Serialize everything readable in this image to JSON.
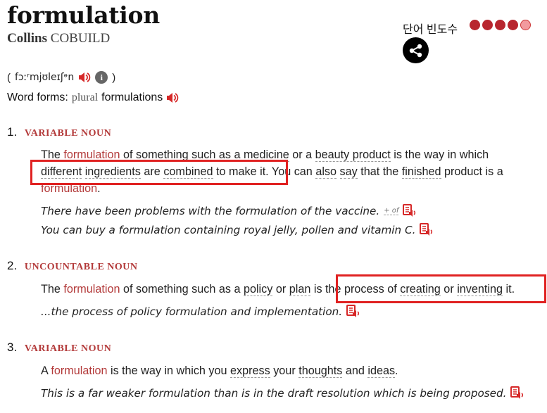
{
  "header": {
    "headword": "formulation",
    "dictionary_brand": "Collins",
    "dictionary_name": "COBUILD",
    "frequency_label": "단어 빈도수",
    "frequency_level": 4,
    "frequency_max": 5
  },
  "pronunciation": {
    "open": "(",
    "ipa": "fɔːʳmjʊleɪʃᵊn",
    "close": ")"
  },
  "word_forms": {
    "label": "Word forms:",
    "plural_label": "plural",
    "plural_value": "formulations"
  },
  "senses": [
    {
      "number": "1.",
      "pos": "VARIABLE NOUN",
      "definition_parts": [
        "The ",
        "formulation",
        " of something such as a ",
        "medicine",
        " or a ",
        "beauty product",
        " is the way in which ",
        "different",
        " ",
        "ingredients",
        " are ",
        "combined",
        " to make it.",
        " You can ",
        "also",
        " ",
        "say",
        " that the ",
        "finished",
        " product is a ",
        "formulation",
        "."
      ],
      "examples": [
        {
          "text": "There have been problems with the formulation of the vaccine.",
          "extra": "+ of"
        },
        {
          "text": "You can buy a formulation containing royal jelly, pollen and vitamin C."
        }
      ]
    },
    {
      "number": "2.",
      "pos": "UNCOUNTABLE NOUN",
      "definition_parts": [
        "The ",
        "formulation",
        " of something such as a ",
        "policy",
        " or ",
        "plan",
        " is ",
        "the process of ",
        "creating",
        " or ",
        "inventing",
        " it."
      ],
      "examples": [
        {
          "text": "...the process of policy formulation and implementation."
        }
      ]
    },
    {
      "number": "3.",
      "pos": "VARIABLE NOUN",
      "definition_parts": [
        "A ",
        "formulation",
        " is the way in which you ",
        "express",
        " your ",
        "thoughts",
        " and ",
        "ideas",
        "."
      ],
      "examples": [
        {
          "text": "This is a far weaker formulation than is in the draft resolution which is being proposed."
        }
      ]
    }
  ],
  "colors": {
    "accent": "#b33a3a",
    "highlight_box": "#e02222",
    "freq_dot": "#b8262f"
  },
  "icons": [
    "share-icon",
    "speaker-icon",
    "info-icon",
    "example-audio-icon"
  ]
}
